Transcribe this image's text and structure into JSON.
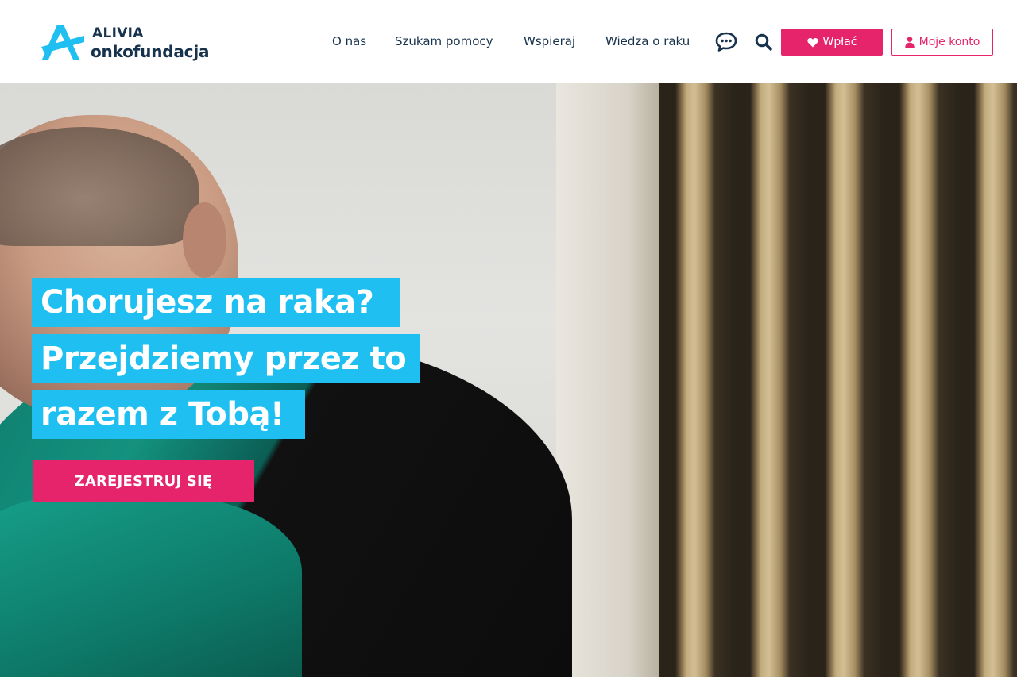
{
  "brand": {
    "name_line1": "ALIVIA",
    "name_line2": "onkofundacja",
    "logo_icon": "alivia-a-logo-icon",
    "primary_color": "#17324d",
    "accent_color": "#1fc0f1",
    "cta_color": "#e6246b"
  },
  "nav": {
    "items": [
      {
        "label": "O nas"
      },
      {
        "label": "Szukam pomocy"
      },
      {
        "label": "Wspieraj"
      },
      {
        "label": "Wiedza o raku"
      }
    ],
    "chat_icon": "chat-bubble-icon",
    "search_icon": "search-icon",
    "donate_button": {
      "label": "Wpłać",
      "icon": "heart-icon"
    },
    "account_button": {
      "label": "Moje konto",
      "icon": "user-icon"
    }
  },
  "hero": {
    "headline_lines": [
      "Chorujesz na raka?",
      "Przejdziemy przez to",
      "razem z Tobą!"
    ],
    "cta_label": "ZAREJESTRUJ SIĘ"
  }
}
